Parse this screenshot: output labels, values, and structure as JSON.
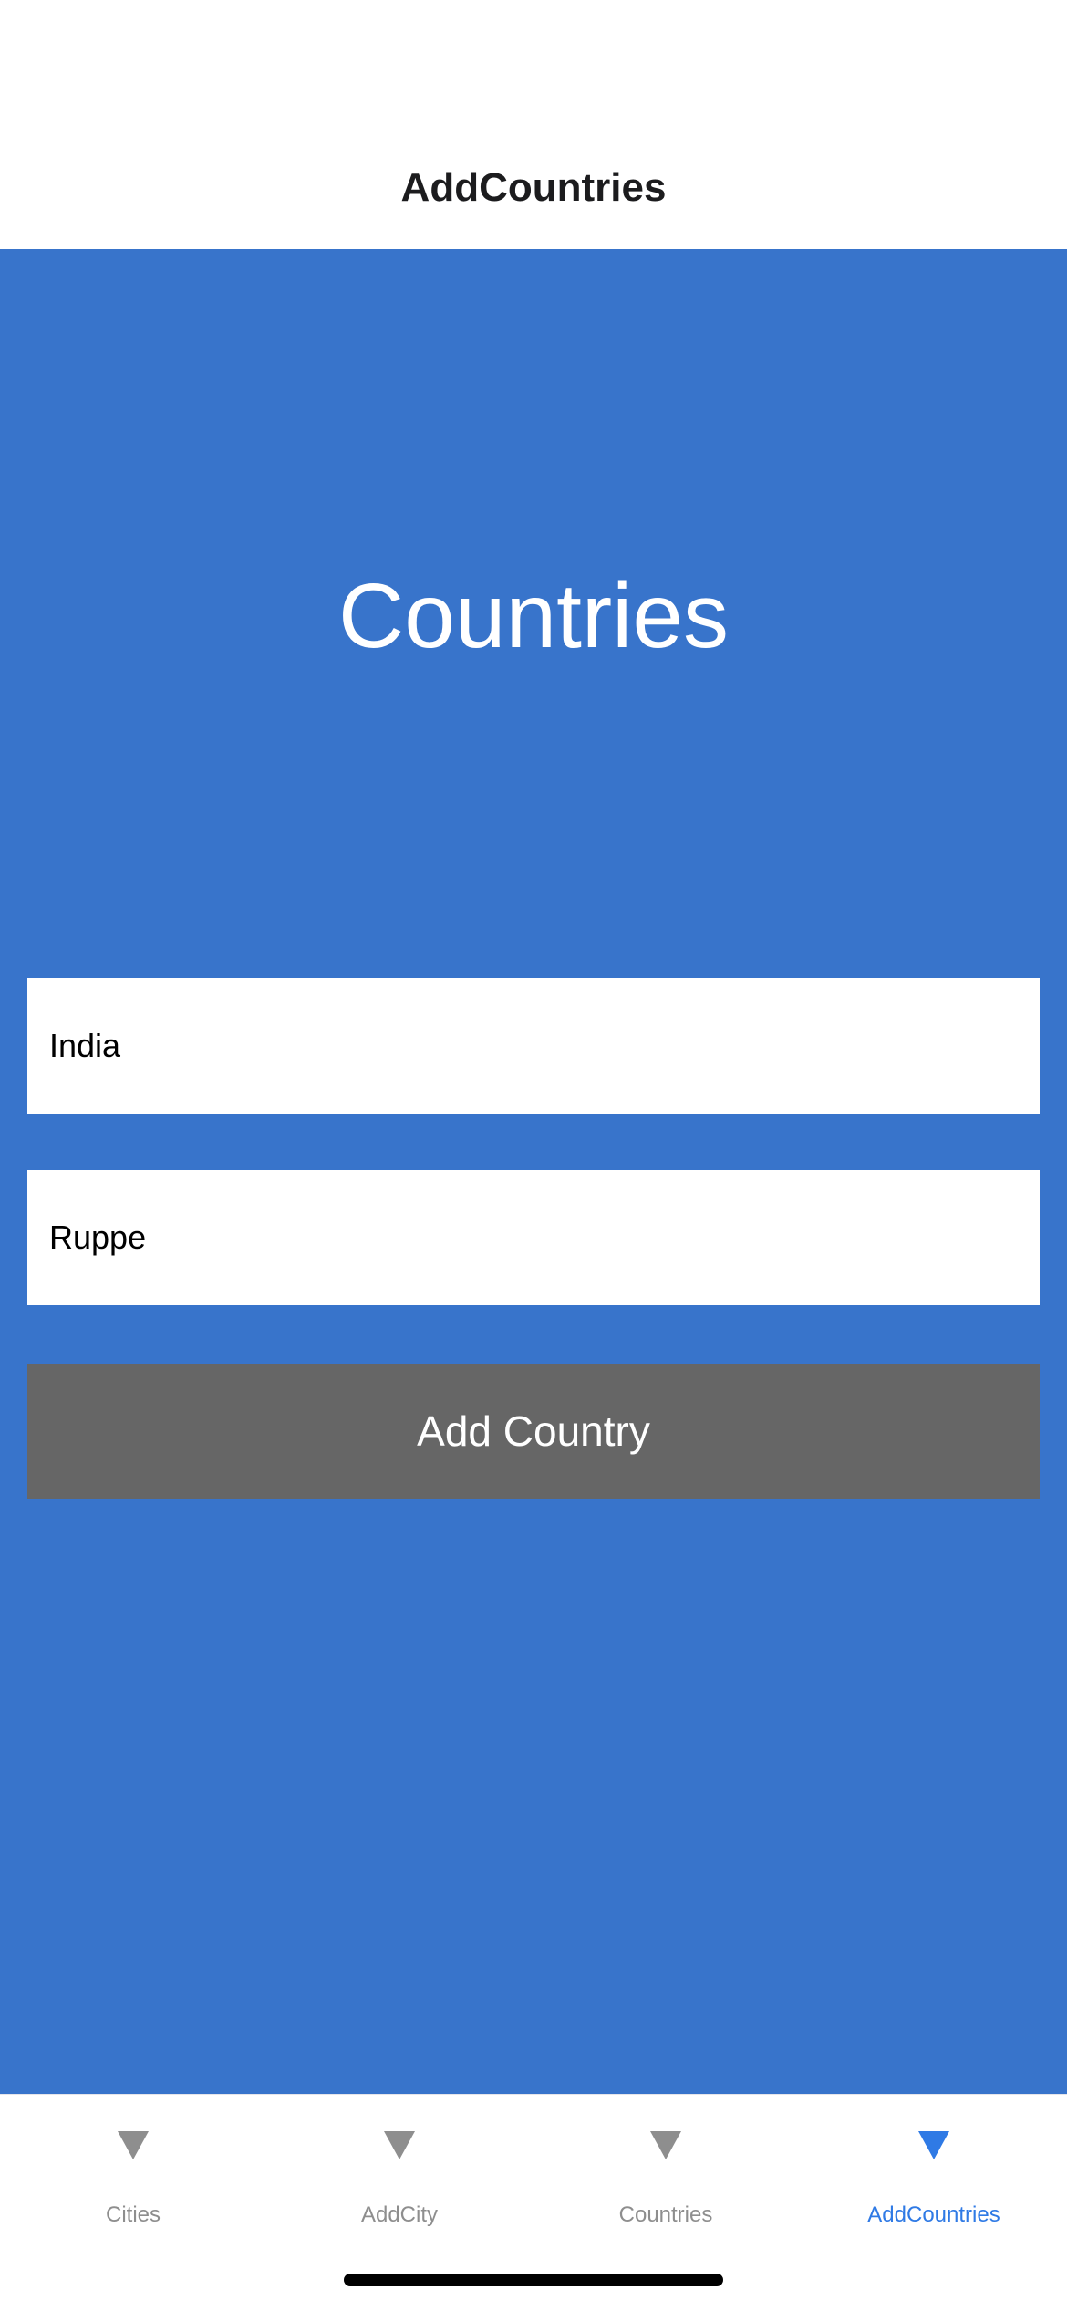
{
  "header": {
    "title": "AddCountries"
  },
  "main": {
    "title": "Countries",
    "country_name": {
      "value": "India",
      "placeholder": ""
    },
    "currency": {
      "value": "Ruppe",
      "placeholder": ""
    },
    "add_button_label": "Add Country"
  },
  "tabbar": {
    "tabs": [
      {
        "label": "Cities",
        "icon": "triangle-down-icon",
        "active": false
      },
      {
        "label": "AddCity",
        "icon": "triangle-down-icon",
        "active": false
      },
      {
        "label": "Countries",
        "icon": "triangle-down-icon",
        "active": false
      },
      {
        "label": "AddCountries",
        "icon": "triangle-down-icon",
        "active": true
      }
    ]
  },
  "colors": {
    "content_background": "#3874cb",
    "button_background": "#666666",
    "active_tab": "#2f7ae5",
    "inactive_tab": "#8e8e8e"
  }
}
